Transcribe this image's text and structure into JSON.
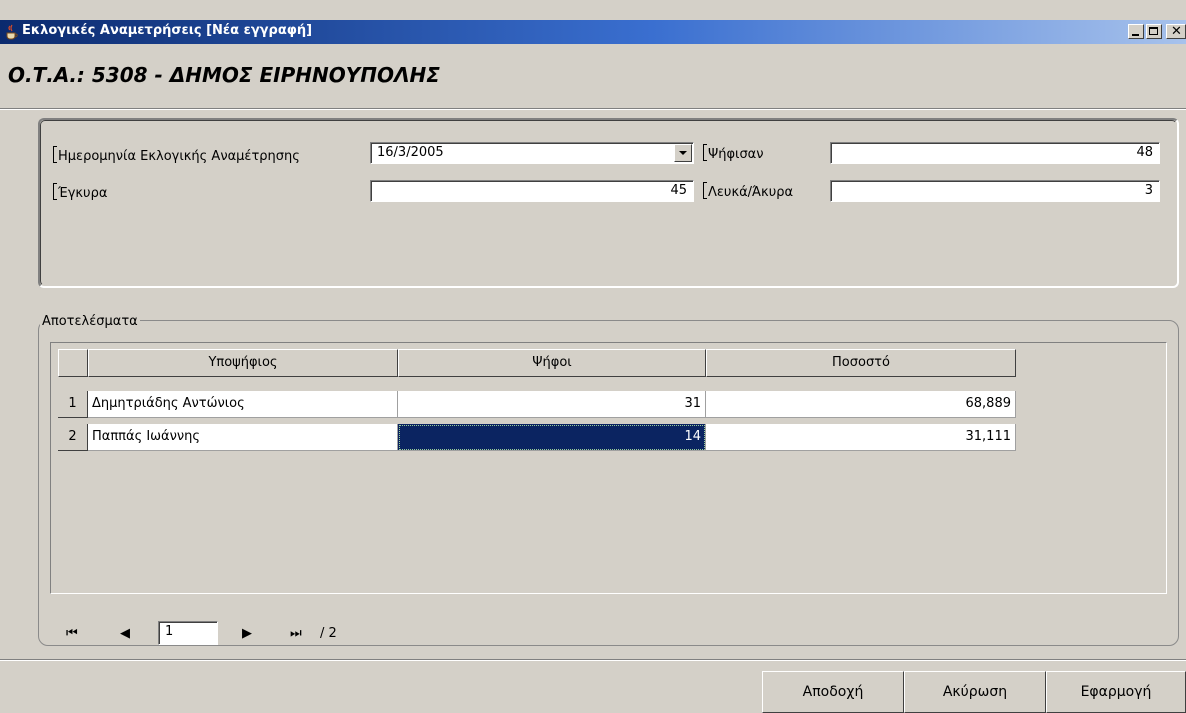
{
  "window": {
    "title": "Εκλογικές Αναμετρήσεις [Νέα εγγραφή]",
    "icon": "java-cup-icon"
  },
  "heading": "Ο.Τ.Α.: 5308 - ΔΗΜΟΣ ΕΙΡΗΝΟΥΠΟΛΗΣ",
  "form": {
    "date_label": "Ημερομηνία Εκλογικής Αναμέτρησης",
    "date_value": "16/3/2005",
    "voted_label": "Ψήφισαν",
    "voted_value": "48",
    "valid_label": "Έγκυρα",
    "valid_value": "45",
    "blank_label": "Λευκά/Άκυρα",
    "blank_value": "3"
  },
  "results": {
    "title": "Αποτελέσματα",
    "columns": [
      "Υποψήφιος",
      "Ψήφοι",
      "Ποσοστό"
    ],
    "rows": [
      {
        "num": "1",
        "candidate": "Δημητριάδης Αντώνιος",
        "votes": "31",
        "percent": "68,889"
      },
      {
        "num": "2",
        "candidate": "Παππάς Ιωάννης",
        "votes": "14",
        "percent": "31,111"
      }
    ]
  },
  "navigator": {
    "current_page": "1",
    "total": "/ 2"
  },
  "buttons": {
    "accept": "Αποδοχή",
    "cancel": "Ακύρωση",
    "apply": "Εφαρμογή"
  },
  "colors": {
    "title_bar_start": "#0b2a6e",
    "selection": "#0b2461",
    "window_bg": "#d4d0c8"
  }
}
